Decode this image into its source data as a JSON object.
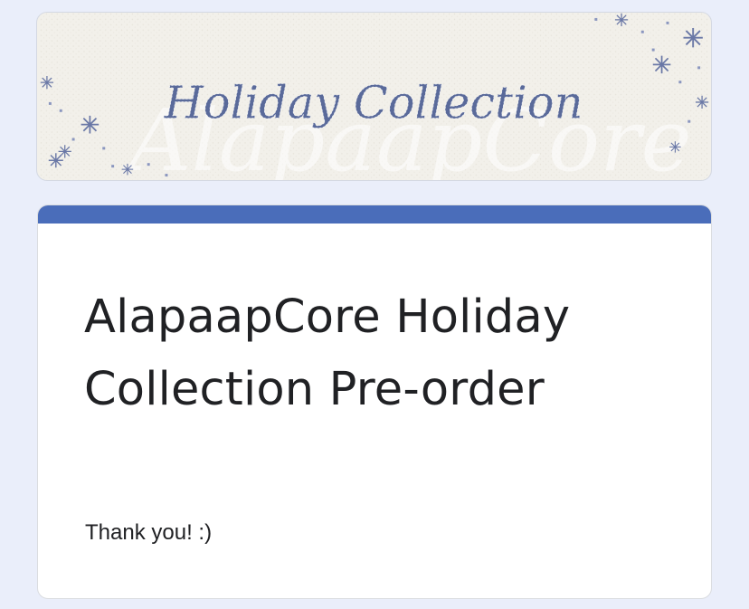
{
  "banner": {
    "title": "Holiday Collection",
    "watermark": "AlapaapCore",
    "colors": {
      "paper": "#f2f0ea",
      "stitch": "#5a6a9a",
      "frost": "#ffffff"
    },
    "icons": [
      "snowflake-icon"
    ]
  },
  "form": {
    "title": "AlapaapCore Holiday Collection Pre-order",
    "description": "Thank you! :)",
    "accent_color": "#4a6dba"
  }
}
